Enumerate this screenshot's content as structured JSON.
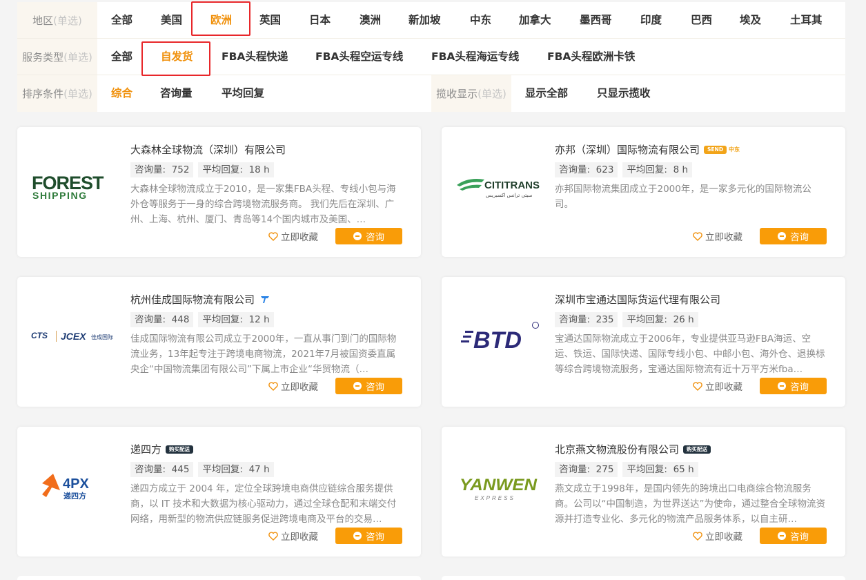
{
  "filters": {
    "region": {
      "label": "地区",
      "hint": "(单选)",
      "options": [
        "全部",
        "美国",
        "欧洲",
        "英国",
        "日本",
        "澳洲",
        "新加坡",
        "中东",
        "加拿大",
        "墨西哥",
        "印度",
        "巴西",
        "埃及",
        "土耳其"
      ],
      "selected": "欧洲"
    },
    "service": {
      "label": "服务类型",
      "hint": "(单选)",
      "options": [
        "全部",
        "自发货",
        "FBA头程快递",
        "FBA头程空运专线",
        "FBA头程海运专线",
        "FBA头程欧洲卡铁"
      ],
      "selected": "自发货"
    },
    "sort": {
      "label": "排序条件",
      "hint": "(单选)",
      "options": [
        "综合",
        "咨询量",
        "平均回复"
      ],
      "selected": "综合"
    },
    "collect": {
      "label": "揽收显示",
      "hint": "(单选)",
      "options": [
        "显示全部",
        "只显示揽收"
      ]
    }
  },
  "ui": {
    "consult_label": "咨询",
    "favorite_label": "立即收藏",
    "inquiry_prefix": "咨询量:",
    "reply_prefix": "平均回复:"
  },
  "accent_color": "#f0900b",
  "button_color": "#f99c08",
  "highlight_color": "#e8272a",
  "companies": [
    {
      "name": "大森林全球物流（深圳）有限公司",
      "inquiries": "752",
      "reply": "18 h",
      "desc": "大森林全球物流成立于2010，是一家集FBA头程、专线小包与海外仓等服务于一身的综合跨境物流服务商。 我们先后在深圳、广州、上海、杭州、厦门、青岛等14个国内城市及美国、…",
      "logo": {
        "line1": "FOREST",
        "line2": "SHIPPING"
      }
    },
    {
      "name": "亦邦（深圳）国际物流有限公司",
      "badge": "SEND",
      "badge_extra": "中东",
      "inquiries": "623",
      "reply": "8 h",
      "desc": "亦邦国际物流集团成立于2000年，是一家多元化的国际物流公司。",
      "logo": {
        "line1": "CITITRANS",
        "line2": "سيتي ترانس اكسبريس"
      }
    },
    {
      "name": "杭州佳成国际物流有限公司",
      "inquiries": "448",
      "reply": "12 h",
      "desc": "佳成国际物流有限公司成立于2000年，一直从事门到门的国际物流业务，13年起专注于跨境电商物流，2021年7月被国资委直属央企“中国物流集团有限公司”下属上市企业“华贸物流（…",
      "logo": {
        "line1": "CTS",
        "line2": "JCEX",
        "line3": "佳成国际"
      }
    },
    {
      "name": "深圳市宝通达国际货运代理有限公司",
      "inquiries": "235",
      "reply": "26 h",
      "desc": "宝通达国际物流成立于2006年，专业提供亚马逊FBA海运、空运、铁运、国际快递、国际专线小包、中邮小包、海外仓、退换标等综合跨境物流服务，宝通达国际物流有近十万平方米fba…",
      "logo": {
        "line1": "BTD"
      }
    },
    {
      "name": "递四方",
      "badge": "购买配送",
      "inquiries": "445",
      "reply": "47 h",
      "desc": "递四方成立于 2004 年，定位全球跨境电商供应链综合服务提供商，以 IT 技术和大数据为核心驱动力，通过全球仓配和末端交付网络，用新型的物流供应链服务促进跨境电商及平台的交易…",
      "logo": {
        "line1": "4PX",
        "line2": "递四方"
      }
    },
    {
      "name": "北京燕文物流股份有限公司",
      "badge": "购买配送",
      "inquiries": "275",
      "reply": "65 h",
      "desc": "燕文成立于1998年，是国内领先的跨境出口电商综合物流服务商。公司以“中国制造，为世界送达”为使命，通过整合全球物流资源并打造专业化、多元化的物流产品服务体系，以自主研…",
      "logo": {
        "line1": "YANWEN",
        "line2": "EXPRESS"
      }
    }
  ]
}
